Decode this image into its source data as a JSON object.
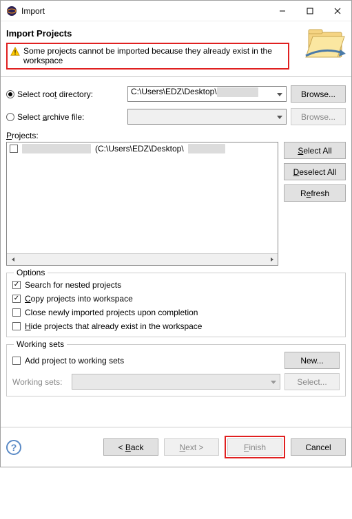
{
  "window": {
    "title": "Import"
  },
  "header": {
    "heading": "Import Projects",
    "warning_text": "Some projects cannot be imported because they already exist in the workspace"
  },
  "source": {
    "root_radio_label_pre": "Select roo",
    "root_radio_label_u": "t",
    "root_radio_label_post": " directory:",
    "archive_radio_label_pre": "Select ",
    "archive_radio_label_u": "a",
    "archive_radio_label_post": "rchive file:",
    "root_path": "C:\\Users\\EDZ\\Desktop\\",
    "archive_path": "",
    "browse_label": "Browse..."
  },
  "projects": {
    "label_pre": "",
    "label_u": "P",
    "label_post": "rojects:",
    "items": [
      {
        "checked": false,
        "path_display": "(C:\\Users\\EDZ\\Desktop\\"
      }
    ],
    "select_all_pre": "",
    "select_all_u": "S",
    "select_all_post": "elect All",
    "deselect_all_pre": "",
    "deselect_all_u": "D",
    "deselect_all_post": "eselect All",
    "refresh_pre": "R",
    "refresh_u": "e",
    "refresh_post": "fresh"
  },
  "options": {
    "legend": "Options",
    "search_nested": {
      "checked": true,
      "label": "Search for nested projects"
    },
    "copy_into": {
      "checked": true,
      "label_pre": "",
      "label_u": "C",
      "label_post": "opy projects into workspace"
    },
    "close_newly": {
      "checked": false,
      "label": "Close newly imported projects upon completion"
    },
    "hide_existing": {
      "checked": false,
      "label_pre": "",
      "label_u": "H",
      "label_post": "ide projects that already exist in the workspace"
    }
  },
  "working_sets": {
    "legend": "Working sets",
    "add_to": {
      "checked": false,
      "label": "Add project to working sets"
    },
    "new_label": "New...",
    "ws_label": "Working sets:",
    "select_label": "Select..."
  },
  "footer": {
    "back_pre": "< ",
    "back_u": "B",
    "back_post": "ack",
    "next_pre": "",
    "next_u": "N",
    "next_post": "ext >",
    "finish_pre": "",
    "finish_u": "F",
    "finish_post": "inish",
    "cancel": "Cancel"
  }
}
